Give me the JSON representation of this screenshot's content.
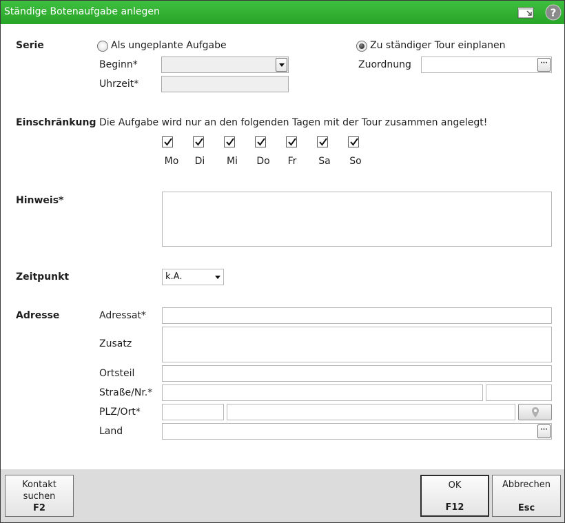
{
  "window": {
    "title": "Ständige Botenaufgabe anlegen"
  },
  "serie": {
    "label": "Serie",
    "option_unplanned": "Als ungeplante Aufgabe",
    "option_tour": "Zu ständiger Tour einplanen",
    "selected": "tour",
    "beginn_label": "Beginn*",
    "beginn_value": "",
    "uhrzeit_label": "Uhrzeit*",
    "uhrzeit_value": "",
    "zuordnung_label": "Zuordnung",
    "zuordnung_value": ""
  },
  "einschraenkung": {
    "label": "Einschränkung",
    "text": "Die Aufgabe wird nur an den folgenden Tagen mit der Tour zusammen angelegt!",
    "days": [
      {
        "label": "Mo",
        "checked": true
      },
      {
        "label": "Di",
        "checked": true
      },
      {
        "label": "Mi",
        "checked": true
      },
      {
        "label": "Do",
        "checked": true
      },
      {
        "label": "Fr",
        "checked": true
      },
      {
        "label": "Sa",
        "checked": true
      },
      {
        "label": "So",
        "checked": true
      }
    ]
  },
  "hinweis": {
    "label": "Hinweis*",
    "value": ""
  },
  "zeitpunkt": {
    "label": "Zeitpunkt",
    "value": "k.A."
  },
  "adresse": {
    "label": "Adresse",
    "adressat_label": "Adressat*",
    "zusatz_label": "Zusatz",
    "ortsteil_label": "Ortsteil",
    "strasse_label": "Straße/Nr.*",
    "plz_label": "PLZ/Ort*",
    "land_label": "Land"
  },
  "footer": {
    "kontakt_line1": "Kontakt",
    "kontakt_line2": "suchen",
    "kontakt_key": "F2",
    "ok_label": "OK",
    "ok_key": "F12",
    "abbrechen_label": "Abbrechen",
    "abbrechen_key": "Esc"
  },
  "colors": {
    "titlebar": "#2eb02e",
    "footer": "#dcdcdc"
  }
}
